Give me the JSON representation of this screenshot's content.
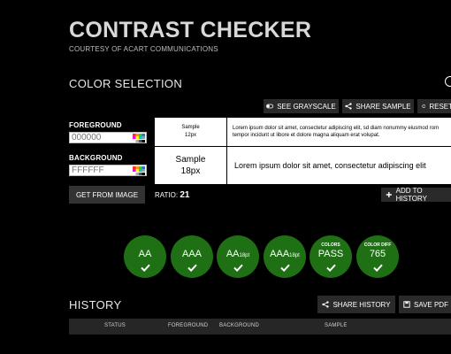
{
  "header": {
    "title": "CONTRAST CHECKER",
    "subtitle": "COURTESY OF ACART COMMUNICATIONS"
  },
  "color_selection": {
    "heading": "COLOR SELECTION",
    "buttons": {
      "grayscale": "SEE GRAYSCALE",
      "share_sample": "SHARE SAMPLE",
      "reset": "RESET"
    }
  },
  "foreground": {
    "label": "FOREGROUND",
    "placeholder": "000000"
  },
  "background": {
    "label": "BACKGROUND",
    "placeholder": "FFFFFF"
  },
  "get_from_image": "GET FROM IMAGE",
  "preview": {
    "small_label_1": "Sample",
    "small_label_2": "12px",
    "small_text": "Lorem ipsum dolor sit amet, consectetur adipiscing elit, sd diam nonummy eiusmod rom tempor incidunt ut libore et dolore magna aliquam erat volupat.",
    "big_label_1": "Sample",
    "big_label_2": "18px",
    "big_text": "Lorem ipsum dolor sit amet, consectetur adipiscing elit"
  },
  "ratio": {
    "label": "RATIO:",
    "value": "21"
  },
  "add_to_history": "ADD TO HISTORY",
  "badges": [
    {
      "top": "",
      "main": "AA",
      "suffix": ""
    },
    {
      "top": "",
      "main": "AAA",
      "suffix": ""
    },
    {
      "top": "",
      "main": "AA",
      "suffix": "18pt"
    },
    {
      "top": "",
      "main": "AAA",
      "suffix": "18pt"
    },
    {
      "top": "COLORS",
      "main": "PASS",
      "suffix": ""
    },
    {
      "top": "COLOR DIFF",
      "main": "765",
      "suffix": ""
    }
  ],
  "badge_color": "#1f6f14",
  "history": {
    "heading": "HISTORY",
    "share_history": "SHARE HISTORY",
    "save_pdf": "SAVE PDF",
    "columns": [
      "STATUS",
      "FOREGROUND",
      "BACKGROUND",
      "SAMPLE"
    ]
  }
}
